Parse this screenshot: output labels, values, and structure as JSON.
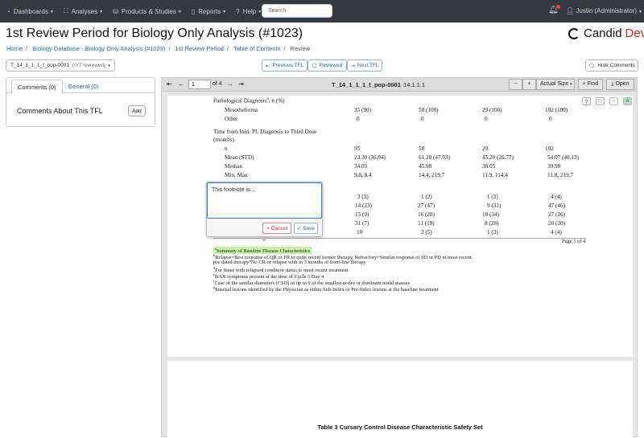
{
  "nav": {
    "items": [
      {
        "icon": "dashboard-icon",
        "glyph": "◔",
        "label": "Dashboards"
      },
      {
        "icon": "analyses-icon",
        "glyph": "⛶",
        "label": "Analyses"
      },
      {
        "icon": "database-icon",
        "glyph": "⛁",
        "label": "Products & Studies"
      },
      {
        "icon": "reports-icon",
        "glyph": "▯",
        "label": "Reports"
      },
      {
        "icon": "help-icon",
        "glyph": "?",
        "label": "Help"
      }
    ],
    "search_placeholder": "Search",
    "user": "Justin (Administrator)"
  },
  "page": {
    "title": "1st Review Period for Biology Only Analysis (#1023)",
    "brand": "Candid",
    "brand_suffix": "Dev",
    "colors": {
      "navbar": "#343a40",
      "link": "#2a6ebb",
      "brand_accent": "#c62828",
      "highlight": "#c8f0a8"
    }
  },
  "breadcrumb": {
    "items": [
      "Home",
      "Biology Database - Biology Only Analysis (#1023)",
      "1st Review Period",
      "Table of Contents"
    ],
    "current": "Review"
  },
  "toolbar": {
    "tfl_select": "T_14_1_1_1_t_pop-0001",
    "tfl_reviewed": "(0/7 reviewed)",
    "prev": "Previous TFL",
    "reviewed": "Reviewed",
    "next": "Next TFL",
    "hide_comments": "Hide Comments"
  },
  "comments": {
    "tab_comments": "Comments (0)",
    "tab_general": "General (0)",
    "heading": "Comments About This TFL",
    "add": "Add"
  },
  "viewer": {
    "page_value": "1",
    "page_of": "of 4",
    "doc_name": "T_14_1_1_1_t_pop-0001",
    "doc_num": "14.1.1.1",
    "zoom": "Actual Size",
    "find": "Find",
    "open": "Open"
  },
  "table": {
    "rows1": [
      {
        "label": "Pathological Diagnosis",
        "sup": "a",
        "suffix": ", n (%)",
        "vals": [
          "",
          "",
          "",
          ""
        ]
      },
      {
        "label": "Mesothelioma",
        "indent": true,
        "vals": [
          "35 (90)",
          "58 (100)",
          "29 (100)",
          "102 (100)"
        ]
      },
      {
        "label": "Other",
        "indent": true,
        "vals": [
          "0",
          "0",
          "0",
          "0"
        ]
      }
    ],
    "group2": "Time from Initi. PL Diagnosis to Third Dose",
    "group2_unit": "(months)",
    "rows2": [
      {
        "label": "n",
        "vals": [
          "95",
          "58",
          "29",
          "102"
        ]
      },
      {
        "label": "Mean (STD)",
        "vals": [
          "23.30 (36.04)",
          "61.28 (47.03)",
          "45.20 (26.77)",
          "54.07 (40.13)"
        ]
      },
      {
        "label": "Median",
        "vals": [
          "34.03",
          "45.98",
          "38.05",
          "39.90"
        ]
      },
      {
        "label": "Min, Max",
        "vals": [
          "9.8, 8.4",
          "14.4, 219.7",
          "11.9, 114.4",
          "11.8, 219.7"
        ]
      }
    ],
    "rows3": [
      [
        "3  (3)",
        "1 (2)",
        "1 (3)",
        "4 (4)"
      ],
      [
        "14 (23)",
        "27 (47)",
        "9 (31)",
        "47 (46)"
      ],
      [
        "15 (9)",
        "16 (28)",
        "10 (34)",
        "27 (26)"
      ],
      [
        "31 (7)",
        "11 (19)",
        "8 (28)",
        "20 (20)"
      ],
      [
        "10",
        "3 (5)",
        "1 (3)",
        "4 (4)"
      ]
    ],
    "page_label": "Page 1 of 4"
  },
  "footnotes": [
    {
      "sup": "a",
      "text": "Summary of Baseline Disease Characteristics"
    },
    {
      "sup": "b",
      "text": "Relapse=Best response of QR or FR to quite recent former therapy, Refractory=Similar response of SD or PD to most recent"
    },
    {
      "sup": "",
      "text": "pre dated therapy°No CR or relapse with in 3 months of front-line therapy"
    },
    {
      "sup": "d",
      "text": "For those with relapsed condition status to most recent treatment"
    },
    {
      "sup": "e",
      "text": "BAX symptoms present at the time of Cycle 5 Day 4"
    },
    {
      "sup": "f",
      "text": "Case of the similar diameters (CSD) of up to 9 of the smallest nodes or dominant nodal masses"
    },
    {
      "sup": "g",
      "text": "Internal lesions identified by the Physician as either Sub-Index or Pre-Index lesions at the baseline treatment"
    }
  ],
  "popup": {
    "value": "This footnote is...",
    "cancel": "Cancel",
    "save": "Save"
  },
  "page2": {
    "title": "Table 3 Cursary Control Disease Characteristic Safety Set"
  }
}
